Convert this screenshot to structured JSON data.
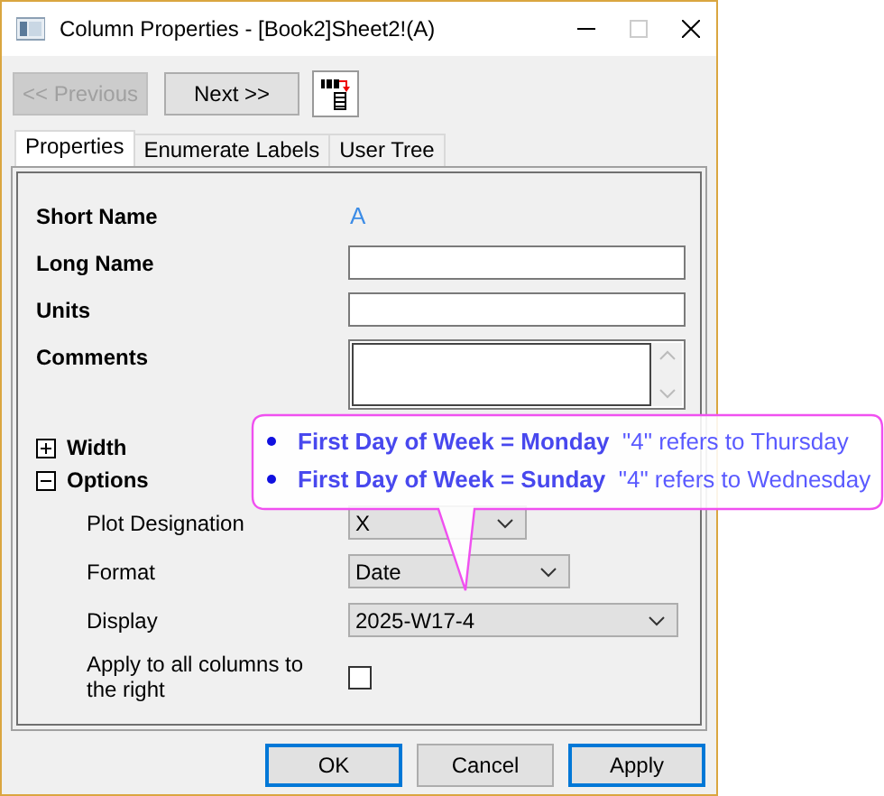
{
  "window": {
    "title": "Column Properties - [Book2]Sheet2!(A)"
  },
  "nav_buttons": [
    {
      "label": "<< Previous",
      "disabled": true
    },
    {
      "label": "Next >>",
      "disabled": false
    }
  ],
  "tabs": [
    {
      "label": "Properties",
      "selected": true
    },
    {
      "label": "Enumerate Labels",
      "selected": false
    },
    {
      "label": "User Tree",
      "selected": false
    }
  ],
  "fields": [
    {
      "kind": "value",
      "label": "Short Name",
      "value": "A"
    },
    {
      "kind": "text",
      "label": "Long Name"
    },
    {
      "kind": "text",
      "label": "Units"
    },
    {
      "kind": "textarea",
      "label": "Comments"
    }
  ],
  "sections": [
    {
      "label": "Width",
      "expanded": false
    },
    {
      "label": "Options",
      "expanded": true,
      "children": [
        {
          "kind": "dropdown",
          "label": "Plot Designation",
          "value": "X"
        },
        {
          "kind": "dropdown",
          "label": "Format",
          "value": "Date"
        },
        {
          "kind": "dropdown",
          "label": "Display",
          "value": "2025-W17-4"
        },
        {
          "kind": "checkbox",
          "label": "Apply to all columns to the right",
          "checked": false
        }
      ]
    }
  ],
  "tooltip": {
    "items": [
      "**First Day of Week = Monday**  \"4\" refers to Thursday",
      "**First Day of Week = Sunday**  \"4\" refers to Wednesday"
    ]
  },
  "buttons": [
    {
      "label": "OK",
      "highlighted": true
    },
    {
      "label": "Cancel",
      "highlighted": false
    },
    {
      "label": "Apply",
      "highlighted": true
    }
  ]
}
